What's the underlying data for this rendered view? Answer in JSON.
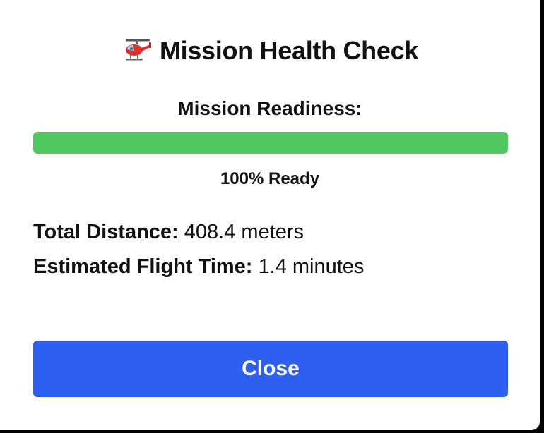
{
  "dialog": {
    "title_icon": "helicopter-icon",
    "title": "Mission Health Check",
    "readiness_label": "Mission Readiness:",
    "readiness_percent": 100,
    "readiness_text": "100% Ready",
    "stats": {
      "distance_label": "Total Distance:",
      "distance_value": "408.4 meters",
      "time_label": "Estimated Flight Time:",
      "time_value": "1.4 minutes"
    },
    "close_label": "Close"
  },
  "colors": {
    "progress_fill": "#4fc860",
    "button": "#2d5ff0"
  }
}
